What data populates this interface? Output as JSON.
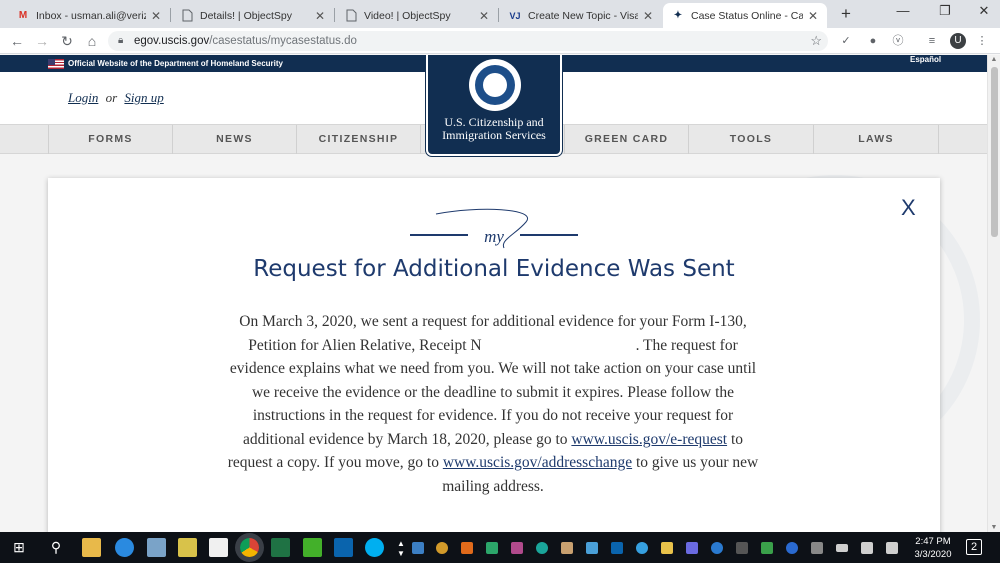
{
  "browser": {
    "tabs": [
      {
        "title": "Inbox - usman.ali@verizon.",
        "icon": "gmail-icon",
        "icon_glyph": "M",
        "icon_color": "#d93025"
      },
      {
        "title": "Details! | ObjectSpy",
        "icon": "blank-page-icon",
        "icon_glyph": "",
        "icon_color": "#5f6368"
      },
      {
        "title": "Video! | ObjectSpy",
        "icon": "blank-page-icon",
        "icon_glyph": "",
        "icon_color": "#5f6368"
      },
      {
        "title": "Create New Topic - VisaJou",
        "icon": "visajourney-icon",
        "icon_glyph": "VJ",
        "icon_color": "#1a3c8c"
      },
      {
        "title": "Case Status Online - Case S",
        "icon": "dhs-seal-icon",
        "icon_glyph": "✦",
        "icon_color": "#112e51"
      }
    ],
    "active_tab_index": 4,
    "close_glyph": "✕",
    "new_tab_glyph": "+",
    "window_controls": [
      "—",
      "❐",
      "✕"
    ],
    "url_host": "egov.uscis.gov",
    "url_path": "/casestatus/mycasestatus.do",
    "avatar_letter": "U"
  },
  "site": {
    "gov_banner": "Official Website of the Department of Homeland Security",
    "language_link": "Español",
    "login_label": "Login",
    "or_label": "or",
    "signup_label": "Sign up",
    "agency_name_line1": "U.S. Citizenship and",
    "agency_name_line2": "Immigration Services",
    "nav": [
      "FORMS",
      "NEWS",
      "CITIZENSHIP",
      "GREEN CARD",
      "TOOLS",
      "LAWS"
    ],
    "brand_color": "#112e51"
  },
  "status": {
    "close_label": "X",
    "flourish_text": "my",
    "title": "Request for Additional Evidence Was Sent",
    "line1": "On March 3, 2020, we sent a request for additional evidence for your Form I-130,",
    "line2a": "Petition for Alien Relative, Receipt N",
    "line2b": ". The request for",
    "line3": "evidence explains what we need from you. We will not take action on your case until",
    "line4": "we receive the evidence or the deadline to submit it expires. Please follow the",
    "line5": "instructions in the request for evidence. If you do not receive your request for",
    "line6a": "additional evidence by March 18, 2020, please go to ",
    "link1": "www.uscis.gov/e-request",
    "line6b": " to",
    "line7a": "request a copy. If you move, go to ",
    "link2": "www.uscis.gov/addresschange",
    "line7b": " to give us your new",
    "line8": "mailing address."
  },
  "taskbar": {
    "time": "2:47 PM",
    "date": "3/3/2020",
    "notification_count": "2"
  }
}
